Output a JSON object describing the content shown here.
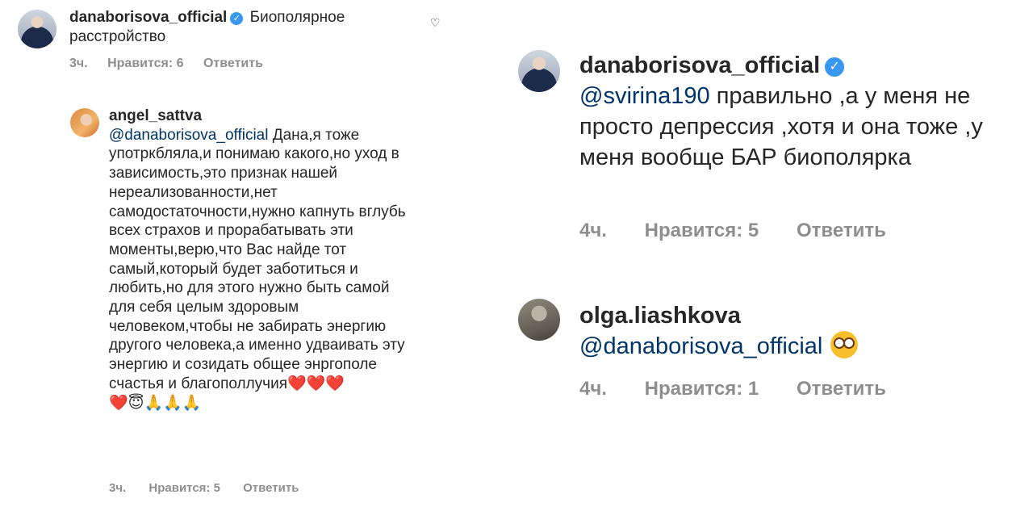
{
  "left": {
    "comment1": {
      "username": "danaborisova_official",
      "verified_icon": "check-circle-icon",
      "text": "Биополярное расстройство",
      "time": "3ч.",
      "likes": "Нравится: 6",
      "reply": "Ответить"
    },
    "comment2": {
      "username": "angel_sattva",
      "mention": "@danaborisova_official",
      "text": "Дана,я тоже употркбляла,и понимаю какого,но уход в зависимость,это признак нашей нереализованности,нет самодостаточности,нужно капнуть вглубь всех страхов и прорабатывать эти моменты,верю,что Вас найде  тот самый,который будет заботиться и любить,но для этого нужно быть самой для себя целым здоровым человеком,чтобы не забирать энергию другого человека,а именно удваивать эту энергию и созидать общее энргополе счастья и благополлучия",
      "emojis1": "❤️❤️❤️",
      "emojis2": "❤️😇🙏🙏🙏",
      "time": "3ч.",
      "likes": "Нравится: 5",
      "reply": "Ответить"
    }
  },
  "right": {
    "comment3": {
      "username": "danaborisova_official",
      "verified_icon": "check-circle-icon",
      "mention": "@svirina190",
      "text": "правильно ,а у меня не просто депрессия ,хотя и она тоже ,у меня вообще БАР биополярка",
      "time": "4ч.",
      "likes": "Нравится: 5",
      "reply": "Ответить"
    },
    "comment4": {
      "username": "olga.liashkova",
      "mention": "@danaborisova_official",
      "emoji_icon": "flushed-face-icon",
      "time": "4ч.",
      "likes": "Нравится: 1",
      "reply": "Ответить"
    }
  }
}
